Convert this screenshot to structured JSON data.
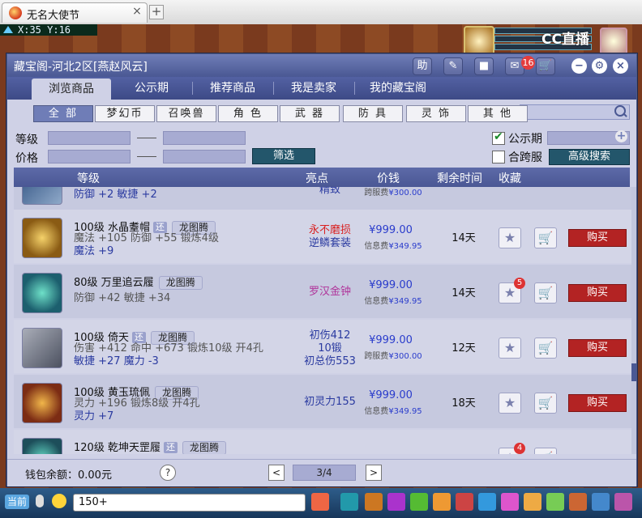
{
  "browser": {
    "tab_title": "无名大使节",
    "tab_close": "×",
    "new_tab": "+"
  },
  "hud": {
    "coords": "X:35 Y:16",
    "stream_logo": "CC直播"
  },
  "panel": {
    "title": "藏宝阁-河北2区[燕赵风云]",
    "title_buttons": [
      "助",
      "✎",
      "■",
      "✉",
      "🛒"
    ],
    "cart_badge": "16",
    "controls": [
      "−",
      "⚙",
      "×"
    ]
  },
  "tabs": [
    "浏览商品",
    "公示期",
    "推荐商品",
    "我是卖家",
    "我的藏宝阁"
  ],
  "categories": [
    "全 部",
    "梦幻币",
    "召唤兽",
    "角 色",
    "武 器",
    "防 具",
    "灵 饰",
    "其 他"
  ],
  "filters": {
    "level_label": "等级",
    "price_label": "价格",
    "filter_button": "筛选",
    "public_label": "公示期",
    "cross_label": "合跨服",
    "advanced_button": "高级搜索"
  },
  "table": {
    "headers": [
      "等级",
      "亮点",
      "价钱",
      "剩余时间",
      "收藏"
    ],
    "fee_label_cross": "跨服费",
    "fee_label_info": "信息费",
    "buy_label": "购买",
    "rows": [
      {
        "name": "",
        "stats_line1": "防御 +2 敏捷 +2",
        "highlight": [
          "精致"
        ],
        "highlight_color": "#2a3aa0",
        "price": "",
        "fee_label": "跨服费",
        "fee_value": "¥300.00",
        "time": "",
        "fav_count": ""
      },
      {
        "name": "100级 水晶耋帽",
        "badge": "还",
        "seller": "龙图腾",
        "stats_line1": "魔法 +105 防御 +55 锻炼4级",
        "stats_line2": "魔法 +9",
        "highlight": [
          "永不磨损",
          "逆鳞套装"
        ],
        "highlight_color": "#d92020",
        "highlight_color2": "#2a3aa0",
        "price": "¥999.00",
        "fee_label": "信息费",
        "fee_value": "¥349.95",
        "time": "14天",
        "fav_count": ""
      },
      {
        "name": "80级 万里追云履",
        "badge": "",
        "seller": "龙图腾",
        "stats_line1": "防御 +42 敏捷 +34",
        "stats_line2": "",
        "highlight": [
          "罗汉金钟"
        ],
        "highlight_color": "#b0339a",
        "price": "¥999.00",
        "fee_label": "信息费",
        "fee_value": "¥349.95",
        "time": "14天",
        "fav_count": "5"
      },
      {
        "name": "100级 倚天",
        "badge": "还",
        "seller": "龙图腾",
        "stats_line1": "伤害 +412 命中 +673 锻炼10级 开4孔",
        "stats_line2": "敏捷 +27 魔力 -3",
        "highlight": [
          "初伤412",
          "10锻",
          "初总伤553"
        ],
        "highlight_color": "#2a3aa0",
        "price": "¥999.00",
        "fee_label": "跨服费",
        "fee_value": "¥300.00",
        "time": "12天",
        "fav_count": ""
      },
      {
        "name": "100级 黄玉琉佩",
        "badge": "",
        "seller": "龙图腾",
        "stats_line1": "灵力 +196 锻炼8级 开4孔",
        "stats_line2": "灵力 +7",
        "highlight": [
          "初灵力155"
        ],
        "highlight_color": "#2a3aa0",
        "price": "¥999.00",
        "fee_label": "信息费",
        "fee_value": "¥349.95",
        "time": "18天",
        "fav_count": ""
      },
      {
        "name": "120级 乾坤天罡履",
        "badge": "还",
        "seller": "龙图腾",
        "stats_line1": "",
        "stats_line2": "",
        "highlight": [],
        "price": "",
        "fee_label": "",
        "fee_value": "",
        "time": "",
        "fav_count": "4"
      }
    ]
  },
  "footer": {
    "wallet": "钱包余额：0.00元",
    "help": "?",
    "prev": "<",
    "page": "3/4",
    "next": ">"
  },
  "chatbar": {
    "current": "当前",
    "input_value": "150+"
  }
}
